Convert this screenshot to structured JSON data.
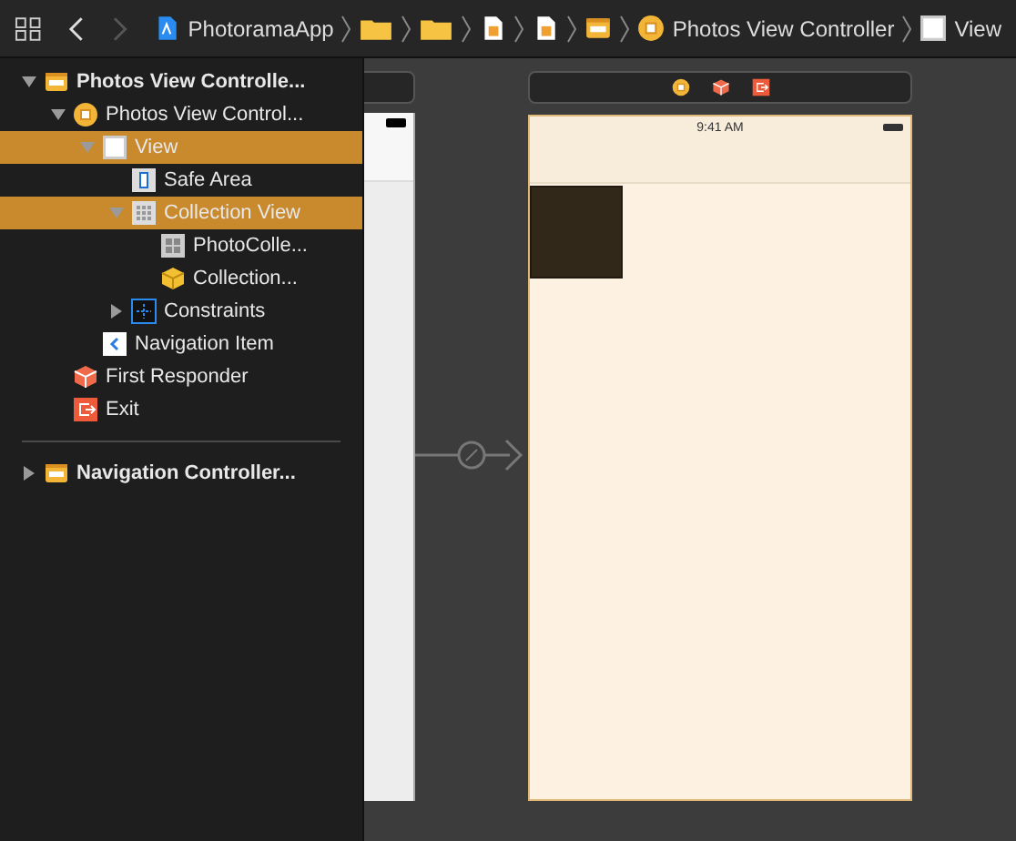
{
  "toolbar": {
    "back": {
      "disabled": false
    },
    "forward": {
      "disabled": true
    },
    "breadcrumbs": [
      {
        "kind": "project",
        "label": "PhotoramaApp"
      },
      {
        "kind": "folder"
      },
      {
        "kind": "folder"
      },
      {
        "kind": "file"
      },
      {
        "kind": "file"
      },
      {
        "kind": "storyboard"
      },
      {
        "kind": "controller",
        "label": "Photos View Controller"
      },
      {
        "kind": "view",
        "label": "View"
      }
    ]
  },
  "outline": [
    {
      "kind": "scene",
      "label": "Photos View Controlle...",
      "expanded": true,
      "selected": false,
      "children": [
        {
          "kind": "controller",
          "label": "Photos View Control...",
          "expanded": true,
          "selected": false,
          "children": [
            {
              "kind": "view",
              "label": "View",
              "expanded": true,
              "selected": true,
              "children": [
                {
                  "kind": "safe-area",
                  "label": "Safe Area",
                  "selected": false
                },
                {
                  "kind": "collection",
                  "label": "Collection View",
                  "expanded": true,
                  "selected": true,
                  "children": [
                    {
                      "kind": "cell",
                      "label": "PhotoColle...",
                      "selected": false
                    },
                    {
                      "kind": "cube",
                      "label": "Collection...",
                      "selected": false
                    }
                  ]
                },
                {
                  "kind": "constraints",
                  "label": "Constraints",
                  "expanded": false,
                  "selected": false
                }
              ]
            },
            {
              "kind": "nav-item",
              "label": "Navigation Item",
              "selected": false
            }
          ]
        },
        {
          "kind": "responder",
          "label": "First Responder",
          "selected": false
        },
        {
          "kind": "exit",
          "label": "Exit",
          "selected": false
        }
      ]
    },
    {
      "kind": "scene",
      "label": "Navigation Controller...",
      "expanded": false,
      "selected": false
    }
  ],
  "device": {
    "time": "9:41 AM"
  }
}
